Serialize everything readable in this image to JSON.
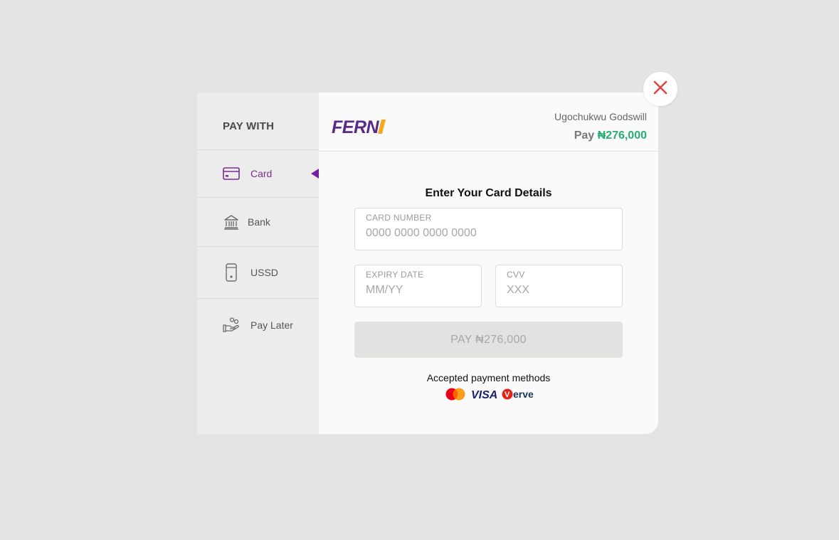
{
  "sidebar": {
    "title": "PAY WITH",
    "items": [
      {
        "label": "Card",
        "icon": "card-icon",
        "active": true
      },
      {
        "label": "Bank",
        "icon": "bank-icon"
      },
      {
        "label": "USSD",
        "icon": "phone-icon"
      },
      {
        "label": "Pay Later",
        "icon": "hand-coins-icon"
      }
    ]
  },
  "header": {
    "logo_text": "FERN",
    "payer_name": "Ugochukwu Godswill",
    "pay_label": "Pay",
    "amount": "₦276,000"
  },
  "form": {
    "title": "Enter Your Card Details",
    "card_number_label": "CARD NUMBER",
    "card_number_placeholder": "0000 0000 0000 0000",
    "expiry_label": "EXPIRY DATE",
    "expiry_placeholder": "MM/YY",
    "cvv_label": "CVV",
    "cvv_placeholder": "XXX",
    "pay_button": "PAY ₦276,000"
  },
  "footer": {
    "accepted_label": "Accepted payment methods",
    "brands": [
      "Mastercard",
      "VISA",
      "Verve"
    ]
  },
  "colors": {
    "accent": "#7b2e8e",
    "amount": "#27ae74",
    "close": "#e04646",
    "logo": "#5b2a86",
    "logo_accent": "#f5a623"
  }
}
